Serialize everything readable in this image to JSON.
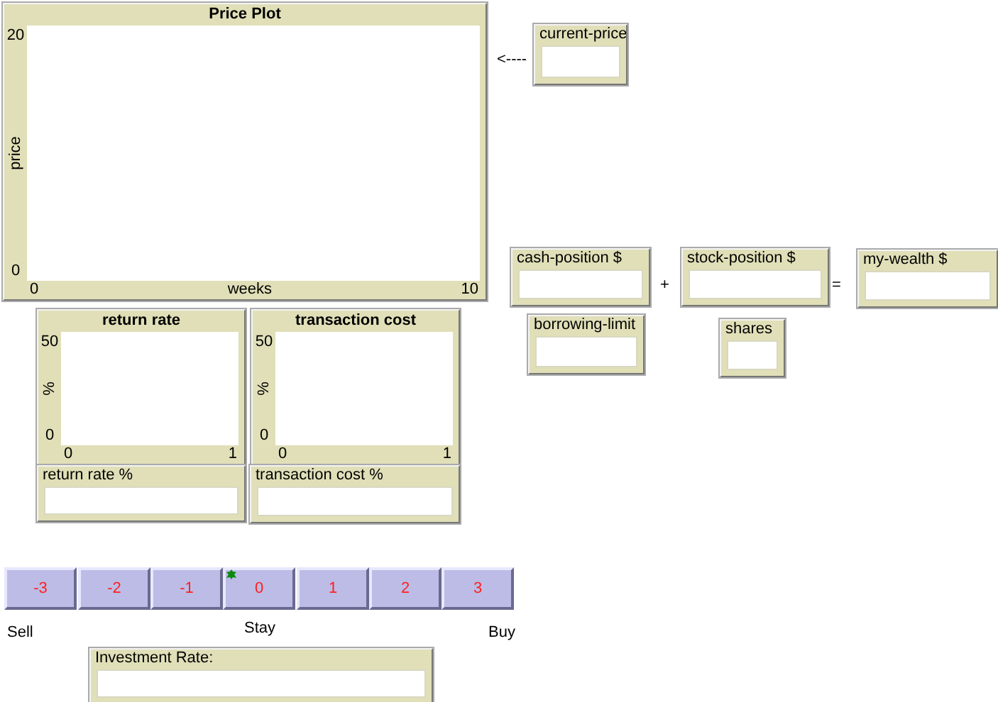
{
  "plots": [
    {
      "title": "Price Plot",
      "ylabel": "price",
      "xlabel": "weeks",
      "y_max": "20",
      "y_min": "0",
      "x_min": "0",
      "x_max": "10"
    },
    {
      "title": "return rate",
      "ylabel": "%",
      "y_max": "50",
      "y_min": "0",
      "x_min": "0",
      "x_max": "1"
    },
    {
      "title": "transaction cost",
      "ylabel": "%",
      "y_max": "50",
      "y_min": "0",
      "x_min": "0",
      "x_max": "1"
    }
  ],
  "monitors": [
    {
      "label": "current-price"
    },
    {
      "label": "cash-position $"
    },
    {
      "label": "stock-position $"
    },
    {
      "label": "my-wealth $"
    },
    {
      "label": "borrowing-limit"
    },
    {
      "label": "shares"
    },
    {
      "label": "return rate %"
    },
    {
      "label": "transaction cost %"
    },
    {
      "label": "Investment Rate:"
    }
  ],
  "notes": [
    "<----",
    "+",
    "=",
    "Sell",
    "Stay",
    "Buy"
  ],
  "buttons": [
    {
      "label": "-3",
      "turtle_icon": false
    },
    {
      "label": "-2",
      "turtle_icon": false
    },
    {
      "label": "-1",
      "turtle_icon": false
    },
    {
      "label": "0",
      "turtle_icon": true
    },
    {
      "label": "1",
      "turtle_icon": false
    },
    {
      "label": "2",
      "turtle_icon": false
    },
    {
      "label": "3",
      "turtle_icon": false
    }
  ]
}
